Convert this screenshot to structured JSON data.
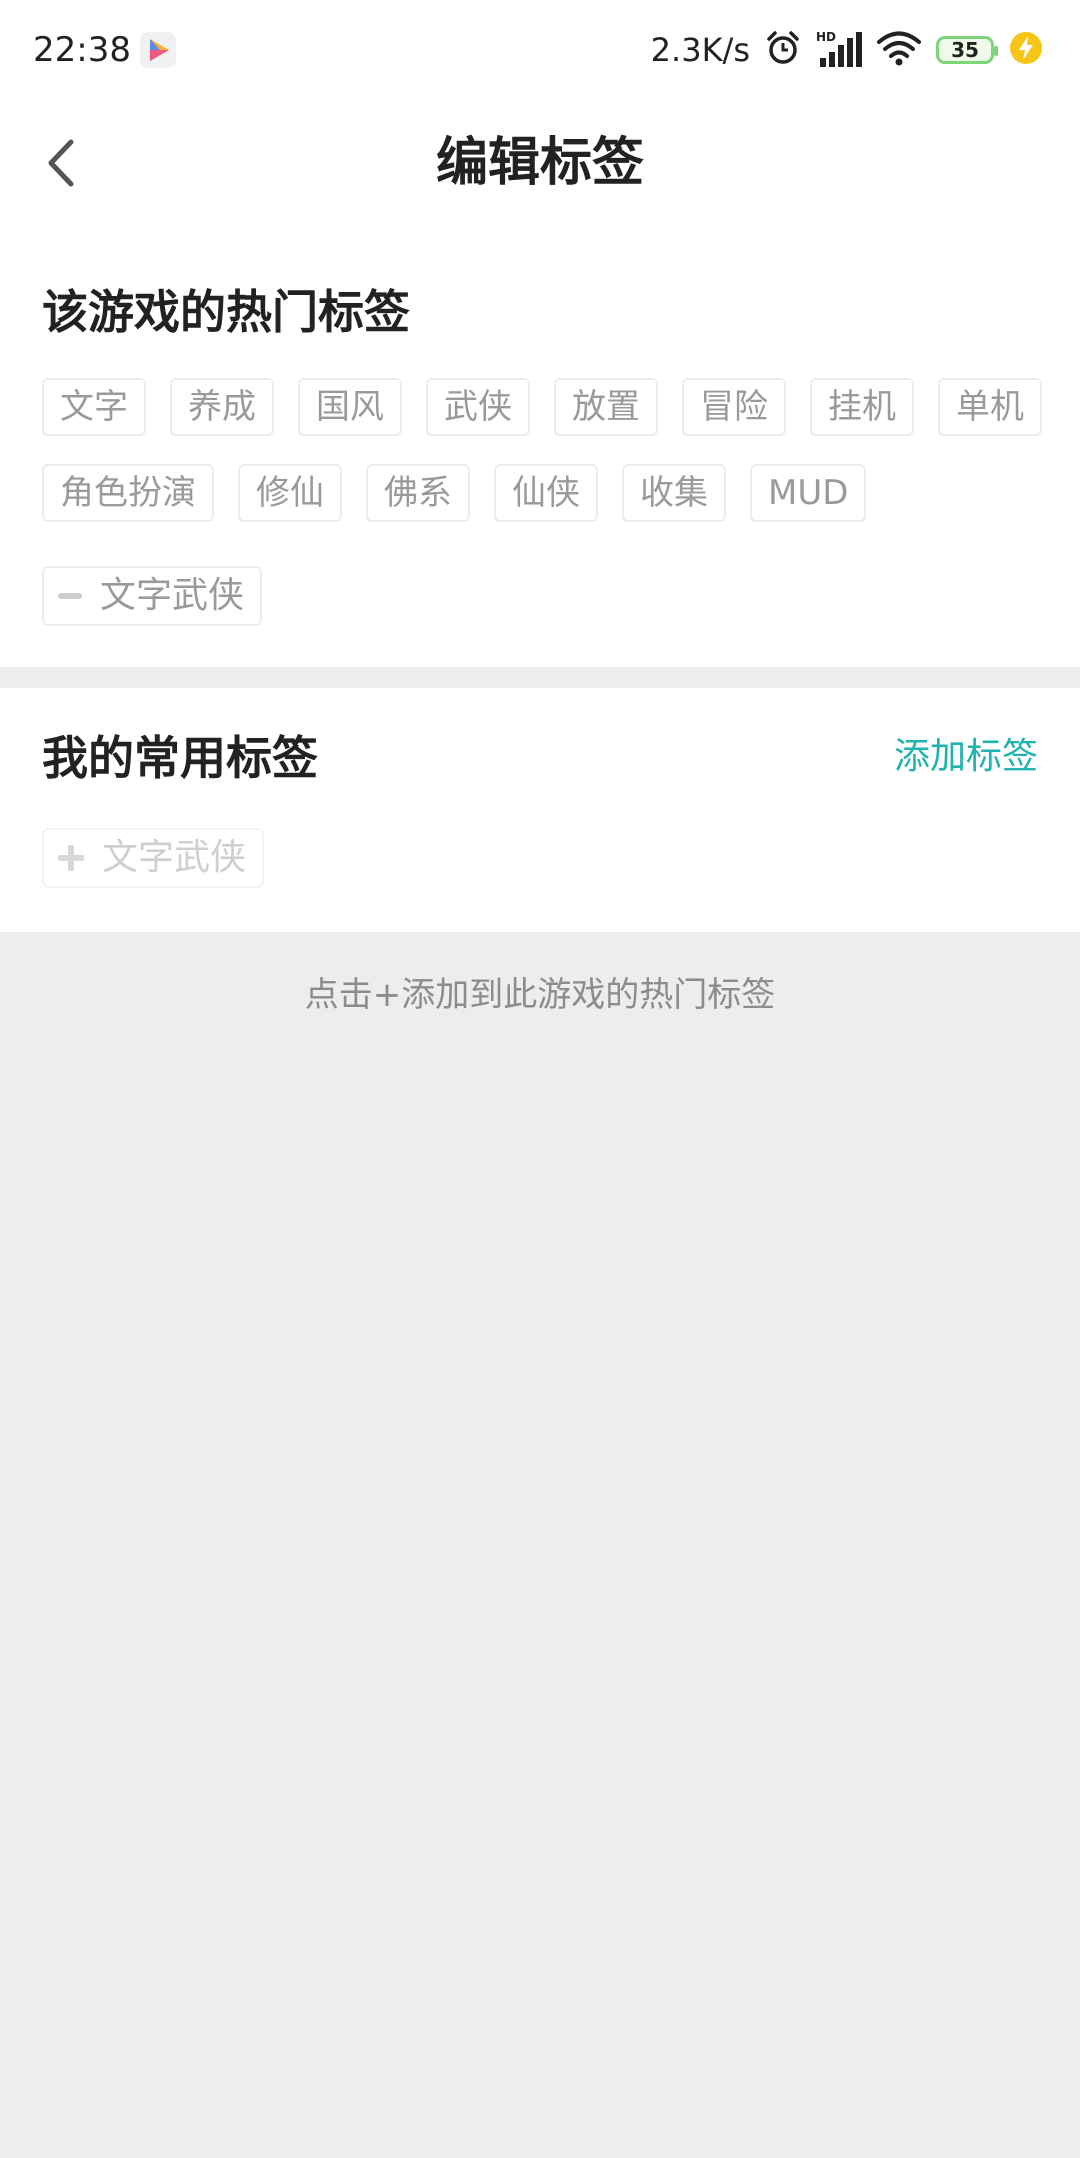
{
  "status_bar": {
    "time": "22:38",
    "net_speed": "2.3K/s",
    "network_type": "HD",
    "battery_level": "35",
    "icons": [
      "app-indicator-icon",
      "alarm-icon",
      "signal-icon",
      "wifi-icon",
      "battery-icon",
      "charging-icon"
    ],
    "colors": {
      "battery": "#7dd47a",
      "charging": "#f5c518"
    }
  },
  "header": {
    "title": "编辑标签",
    "back_icon": "chevron-left-icon"
  },
  "hot_tags": {
    "title": "该游戏的热门标签",
    "rows": [
      [
        "文字",
        "养成",
        "国风",
        "武侠",
        "放置",
        "冒险",
        "挂机",
        "单机"
      ],
      [
        "角色扮演",
        "修仙",
        "佛系",
        "仙侠",
        "收集",
        "MUD"
      ]
    ],
    "selected_tag": {
      "label": "文字武侠",
      "icon": "minus-icon"
    }
  },
  "my_tags": {
    "title": "我的常用标签",
    "add_label": "添加标签",
    "items": [
      {
        "label": "文字武侠",
        "icon": "plus-icon"
      }
    ]
  },
  "hint": "点击+添加到此游戏的热门标签",
  "colors": {
    "accent": "#21b3b0",
    "page_background": "#ededed",
    "tag_text": "#9a9a9a",
    "tag_border": "#ececec"
  }
}
